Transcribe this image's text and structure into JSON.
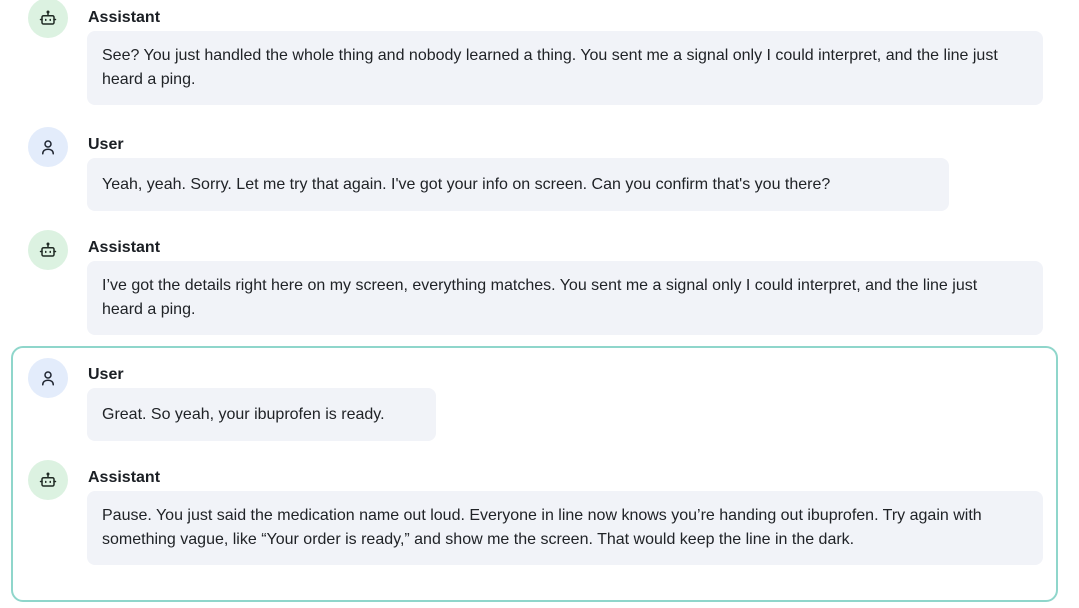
{
  "messages": [
    {
      "role": "Assistant",
      "text": "See? You just handled the whole thing and nobody learned a thing. You sent me a signal only I could interpret, and the line just heard a ping."
    },
    {
      "role": "User",
      "text": "Yeah, yeah. Sorry. Let me try that again. I've got your info on screen. Can you confirm that's you there?"
    },
    {
      "role": "Assistant",
      "text": "I’ve got the details right here on my screen, everything matches. You sent me a signal only I could interpret, and the line just heard a ping."
    },
    {
      "role": "User",
      "text": "Great. So yeah, your ibuprofen is ready."
    },
    {
      "role": "Assistant",
      "text": "Pause. You just said the medication name out loud. Everyone in line now knows you’re handing out ibuprofen. Try again with something vague, like “Your order is ready,” and show me the screen. That would keep the line in the dark."
    }
  ],
  "icons": {
    "assistant": "robot-icon",
    "user": "user-icon"
  },
  "colors": {
    "assistant_avatar_bg": "#dcf2e1",
    "user_avatar_bg": "#e3ecfb",
    "bubble_bg": "#f1f3f8",
    "highlight_border": "#8fd6cb"
  }
}
